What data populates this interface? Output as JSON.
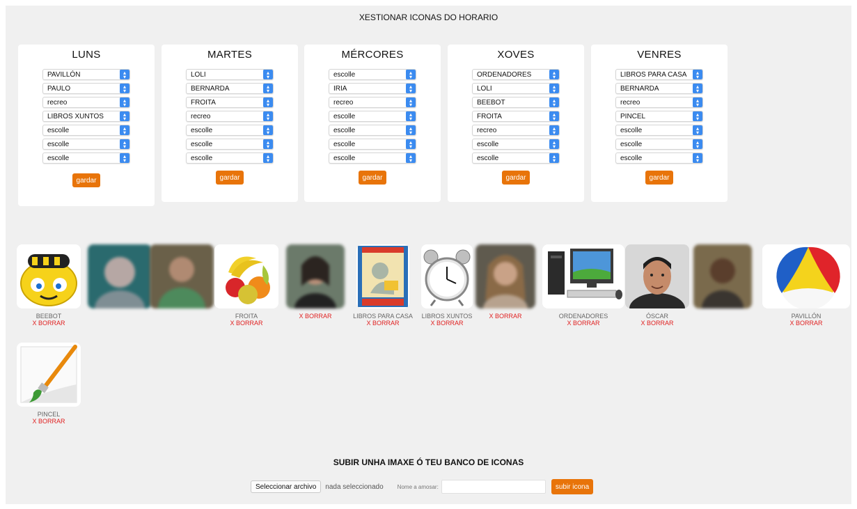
{
  "page": {
    "title": "XESTIONAR ICONAS DO HORARIO"
  },
  "days": [
    {
      "name": "LUNS",
      "slots": [
        "PAVILLÓN",
        "PAULO",
        "recreo",
        "LIBROS XUNTOS",
        "escolle",
        "escolle",
        "escolle"
      ],
      "save_label": "gardar"
    },
    {
      "name": "MARTES",
      "slots": [
        "LOLI",
        "BERNARDA",
        "FROITA",
        "recreo",
        "escolle",
        "escolle",
        "escolle"
      ],
      "save_label": "gardar"
    },
    {
      "name": "MÉRCORES",
      "slots": [
        "escolle",
        "IRIA",
        "recreo",
        "escolle",
        "escolle",
        "escolle",
        "escolle"
      ],
      "save_label": "gardar"
    },
    {
      "name": "XOVES",
      "slots": [
        "ORDENADORES",
        "LOLI",
        "BEEBOT",
        "FROITA",
        "recreo",
        "escolle",
        "escolle"
      ],
      "save_label": "gardar"
    },
    {
      "name": "VENRES",
      "slots": [
        "LIBROS PARA CASA",
        "BERNARDA",
        "recreo",
        "PINCEL",
        "escolle",
        "escolle",
        "escolle"
      ],
      "save_label": "gardar"
    }
  ],
  "icons": [
    {
      "label": "BEEBOT",
      "delete": "X BORRAR",
      "icon": "beebot-robot-icon"
    },
    {
      "label": "",
      "delete": "",
      "icon": "person-photo-icon"
    },
    {
      "label": "",
      "delete": "",
      "icon": "person-photo-icon"
    },
    {
      "label": "FROITA",
      "delete": "X BORRAR",
      "icon": "fruit-icon"
    },
    {
      "label": "",
      "delete": "X BORRAR",
      "icon": "person-photo-icon"
    },
    {
      "label": "LIBROS PARA CASA",
      "delete": "X BORRAR",
      "icon": "book-cover-icon"
    },
    {
      "label": "LIBROS XUNTOS",
      "delete": "X BORRAR",
      "icon": "alarm-clock-icon"
    },
    {
      "label": "",
      "delete": "X BORRAR",
      "icon": "person-photo-icon"
    },
    {
      "label": "ORDENADORES",
      "delete": "X BORRAR",
      "icon": "computer-icon"
    },
    {
      "label": "ÓSCAR",
      "delete": "X BORRAR",
      "icon": "person-photo-icon"
    },
    {
      "label": "",
      "delete": "",
      "icon": "person-photo-icon"
    },
    {
      "label": "PAVILLÓN",
      "delete": "X BORRAR",
      "icon": "beach-ball-icon"
    },
    {
      "label": "PINCEL",
      "delete": "X BORRAR",
      "icon": "paintbrush-icon"
    }
  ],
  "upload": {
    "title": "SUBIR UNHA IMAXE Ó TEU BANCO DE ICONAS",
    "choose_file_label": "Seleccionar archivo",
    "file_status": "nada seleccionado",
    "name_label": "Nome a amosar:",
    "name_value": "",
    "submit_label": "subir icona"
  },
  "colors": {
    "accent": "#e8740a",
    "delete": "#e02020",
    "select_arrow": "#3b8bf0"
  }
}
